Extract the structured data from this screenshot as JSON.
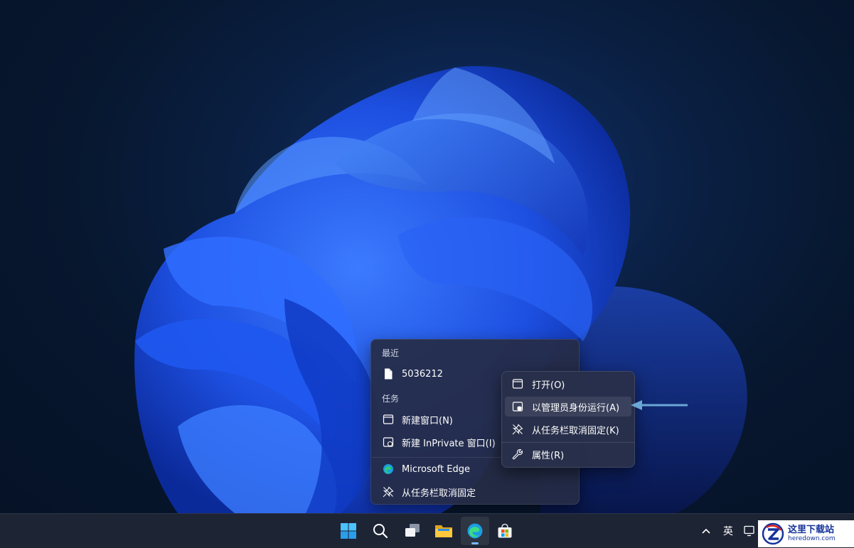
{
  "jumplist": {
    "recent_header": "最近",
    "recent_items": [
      "5036212"
    ],
    "tasks_header": "任务",
    "tasks": [
      "新建窗口(N)",
      "新建 InPrivate 窗口(I)"
    ],
    "app_name": "Microsoft Edge",
    "unpin": "从任务栏取消固定"
  },
  "context_menu": {
    "items": [
      "打开(O)",
      "以管理员身份运行(A)",
      "从任务栏取消固定(K)",
      "属性(R)"
    ],
    "highlighted_item": "以管理员身份运行(A)"
  },
  "taskbar": {
    "apps": [
      "start-icon",
      "search-icon",
      "task-view-icon",
      "file-explorer-icon",
      "edge-icon",
      "store-icon"
    ],
    "active_app": "edge-icon",
    "tray": {
      "language": "英"
    }
  },
  "watermark": {
    "cn": "这里下载站",
    "en": "heredown.com"
  },
  "colors": {
    "accent": "#79b8ff",
    "arrow": "#6aa7d6",
    "menu_bg": "#282f4a"
  }
}
